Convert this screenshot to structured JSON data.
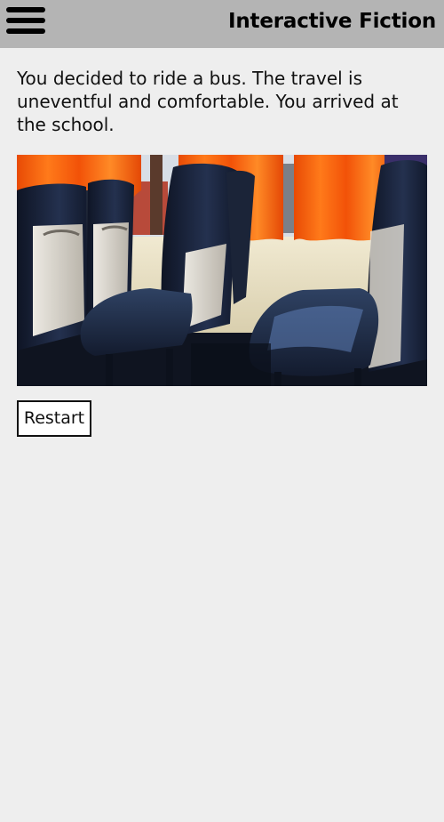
{
  "header": {
    "menu_icon": "hamburger-menu-icon",
    "title": "Interactive Fiction"
  },
  "story": {
    "text": "You decided to ride a bus. The travel is uneventful and comfortable. You arrived at the school."
  },
  "scene_image": {
    "subject": "bus-interior-seats-photo"
  },
  "actions": {
    "restart_label": "Restart"
  },
  "colors": {
    "app_bar": "#b4b4b4",
    "background": "#eeeeee",
    "curtain": "#ff5a0a",
    "seat": "#1d2d4a"
  }
}
